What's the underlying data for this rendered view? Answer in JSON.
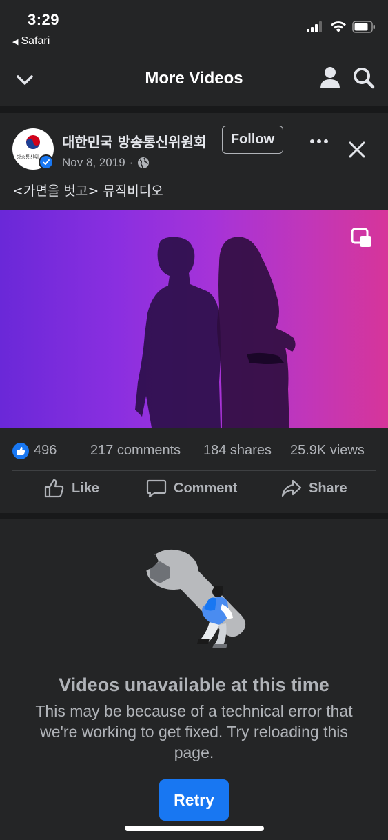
{
  "status_bar": {
    "time": "3:29",
    "back_app": "Safari"
  },
  "header": {
    "title": "More Videos"
  },
  "post": {
    "page_name": "대한민국 방송통신위원회",
    "avatar_text": "방송통신위",
    "follow_label": "Follow",
    "date": "Nov 8, 2019",
    "separator": "·",
    "caption": "<가면을 벗고> 뮤직비디오",
    "stats": {
      "likes": "496",
      "comments": "217 comments",
      "shares": "184 shares",
      "views": "25.9K views"
    },
    "actions": {
      "like": "Like",
      "comment": "Comment",
      "share": "Share"
    }
  },
  "error": {
    "title": "Videos unavailable at this time",
    "body": "This may be because of a technical error that we're working to get fixed. Try reloading this page.",
    "retry_label": "Retry"
  },
  "colors": {
    "background": "#242526",
    "separator": "#18191a",
    "accent": "#1877f2",
    "text_primary": "#e4e6eb",
    "text_secondary": "#b0b3b8"
  },
  "icons": [
    "chevron-down-icon",
    "profile-icon",
    "search-icon",
    "more-icon",
    "close-icon",
    "globe-icon",
    "verified-icon",
    "picture-in-picture-icon",
    "like-icon",
    "comment-icon",
    "share-icon",
    "wrench-illustration"
  ]
}
